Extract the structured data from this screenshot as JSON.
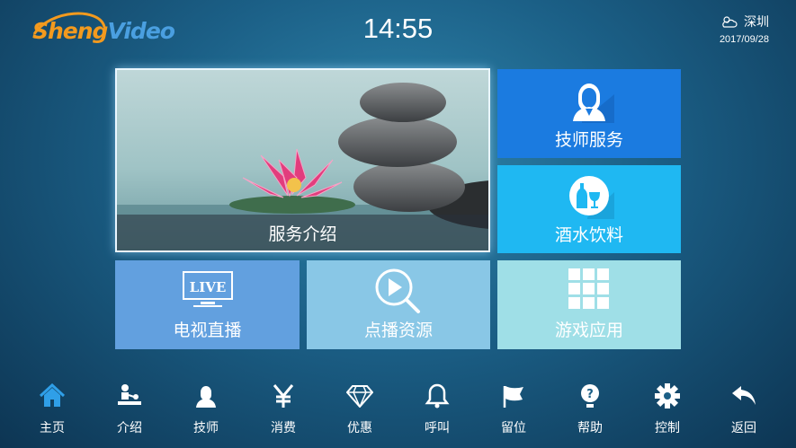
{
  "header": {
    "logo_text_a": "Sheng",
    "logo_text_b": "Video",
    "time": "14:55",
    "city": "深圳",
    "date": "2017/09/28",
    "weather_icon": "cloud-sun-icon"
  },
  "tiles": {
    "service": "服务介绍",
    "technician": "技师服务",
    "drinks": "酒水饮料",
    "tv": "电视直播",
    "tv_badge": "LIVE",
    "vod": "点播资源",
    "games": "游戏应用"
  },
  "nav": [
    {
      "label": "主页",
      "icon": "home-icon",
      "active": true
    },
    {
      "label": "介绍",
      "icon": "massage-icon"
    },
    {
      "label": "技师",
      "icon": "technician-icon"
    },
    {
      "label": "消费",
      "icon": "yen-icon"
    },
    {
      "label": "优惠",
      "icon": "diamond-icon"
    },
    {
      "label": "呼叫",
      "icon": "bell-icon"
    },
    {
      "label": "留位",
      "icon": "flag-icon"
    },
    {
      "label": "帮助",
      "icon": "help-icon"
    },
    {
      "label": "控制",
      "icon": "gear-icon"
    },
    {
      "label": "返回",
      "icon": "back-icon"
    }
  ],
  "colors": {
    "technician_tile": "#1b7be0",
    "drinks_tile": "#1fb8f2",
    "tv_tile": "#62a0df",
    "vod_tile": "#89c7e6",
    "games_tile": "#9fdfe7",
    "nav_active": "#2f9fe8"
  }
}
